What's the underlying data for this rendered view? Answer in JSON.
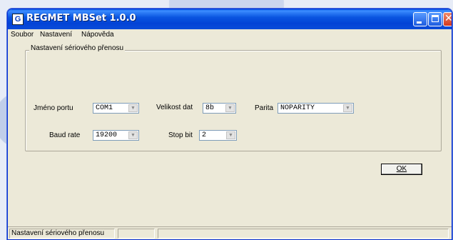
{
  "window": {
    "title": "REGMET MBSet 1.0.0",
    "icon_letter": "G",
    "close_glyph": "✕"
  },
  "menu": {
    "items": [
      "Soubor",
      "Nastavení",
      "Nápověda"
    ]
  },
  "serial": {
    "group_title": "Nastavení sériového přenosu",
    "port_label": "Jméno portu",
    "port_value": "COM1",
    "datasize_label": "Velikost dat",
    "datasize_value": "8b",
    "parity_label": "Parita",
    "parity_value": "NOPARITY",
    "baud_label": "Baud rate",
    "baud_value": "19200",
    "stopbit_label": "Stop bit",
    "stopbit_value": "2",
    "ok_label": "OK"
  },
  "status": {
    "panels": [
      "Nastavení sériového přenosu",
      "",
      ""
    ]
  },
  "colors": {
    "titlebar": "#0a55e0",
    "window_bg": "#ece9d8"
  }
}
